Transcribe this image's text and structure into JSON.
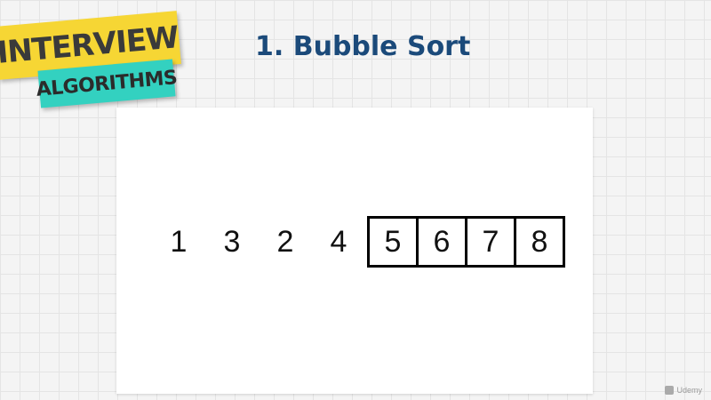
{
  "logo": {
    "line1": "INTERVIEW",
    "line2": "ALGORITHMS"
  },
  "title": "1. Bubble Sort",
  "array": {
    "unsorted": [
      "1",
      "3",
      "2",
      "4"
    ],
    "sorted": [
      "5",
      "6",
      "7",
      "8"
    ]
  },
  "watermark": "Udemy",
  "colors": {
    "title": "#1b4a7a",
    "logo_yellow": "#f6d634",
    "logo_teal": "#33d1c0"
  }
}
